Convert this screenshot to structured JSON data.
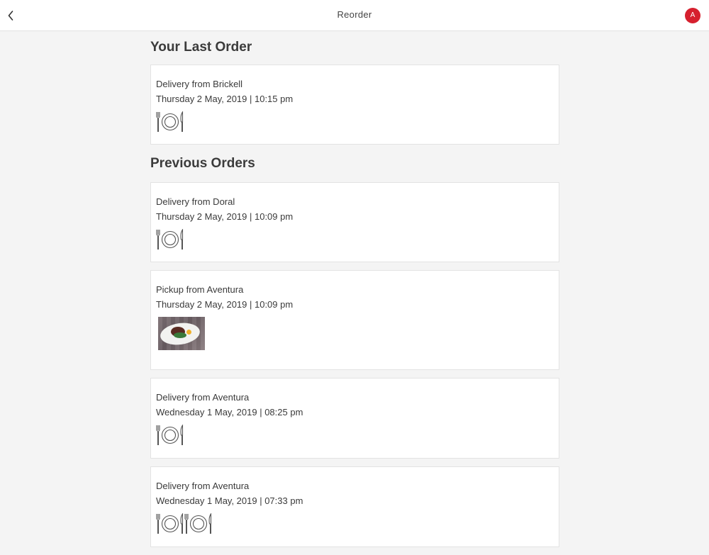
{
  "header": {
    "title": "Reorder",
    "avatar_initial": "A",
    "back_icon": "chevron-left-icon"
  },
  "last_order": {
    "section_title": "Your Last Order",
    "order": {
      "title": "Delivery from Brickell",
      "datetime": "Thursday 2 May, 2019 | 10:15 pm",
      "items": [
        "plate-icon"
      ]
    }
  },
  "previous_orders": {
    "section_title": "Previous Orders",
    "orders": [
      {
        "title": "Delivery from Doral",
        "datetime": "Thursday 2 May, 2019 | 10:09 pm",
        "items": [
          "plate-icon"
        ]
      },
      {
        "title": "Pickup from Aventura",
        "datetime": "Thursday 2 May, 2019 | 10:09 pm",
        "items": [
          "food-photo"
        ]
      },
      {
        "title": "Delivery from Aventura",
        "datetime": "Wednesday 1 May, 2019 | 08:25 pm",
        "items": [
          "plate-icon"
        ]
      },
      {
        "title": "Delivery from Aventura",
        "datetime": "Wednesday 1 May, 2019 | 07:33 pm",
        "items": [
          "plate-icon",
          "plate-icon"
        ]
      }
    ]
  },
  "colors": {
    "accent": "#d6202e",
    "background": "#f4f4f4",
    "card": "#ffffff"
  }
}
